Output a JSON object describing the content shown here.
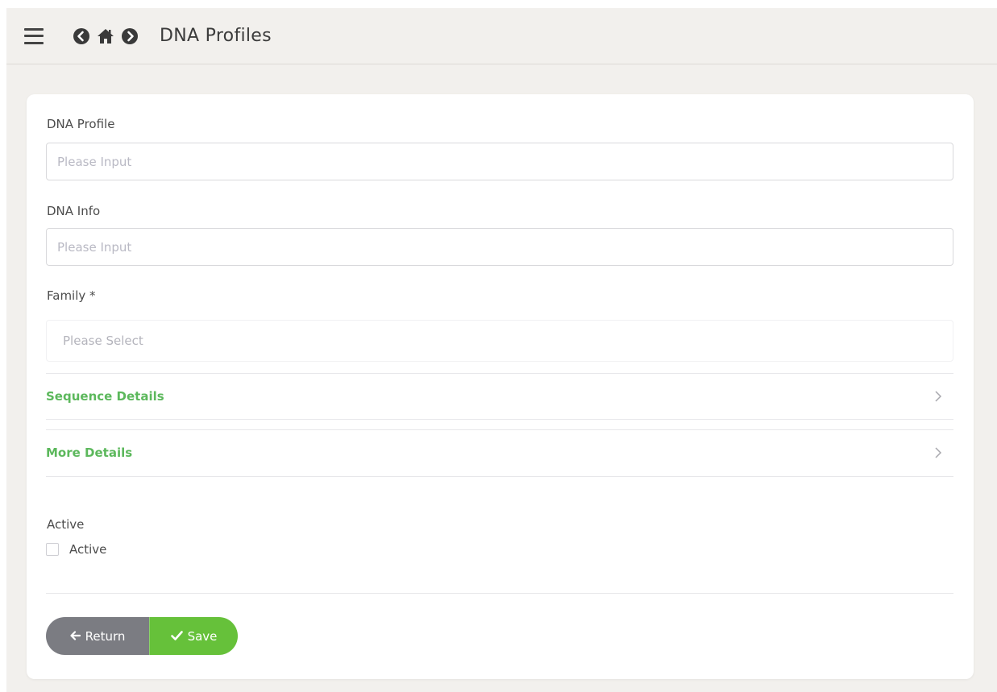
{
  "header": {
    "title": "DNA Profiles",
    "icons": [
      "menu-icon",
      "back-circle-icon",
      "home-icon",
      "forward-circle-icon"
    ]
  },
  "form": {
    "dna_profile": {
      "label": "DNA Profile",
      "placeholder": "Please Input",
      "value": ""
    },
    "dna_info": {
      "label": "DNA Info",
      "placeholder": "Please Input",
      "value": ""
    },
    "family": {
      "label": "Family *",
      "placeholder": "Please Select"
    },
    "sections": [
      {
        "title": "Sequence Details"
      },
      {
        "title": "More Details"
      }
    ],
    "active": {
      "label": "Active",
      "checkbox_label": "Active",
      "checked": false
    }
  },
  "actions": {
    "return_label": "Return",
    "save_label": "Save"
  },
  "colors": {
    "accent_green": "#66c13a",
    "section_green": "#5cb85c",
    "return_gray": "#7b7c82",
    "background": "#f2f0ed"
  }
}
